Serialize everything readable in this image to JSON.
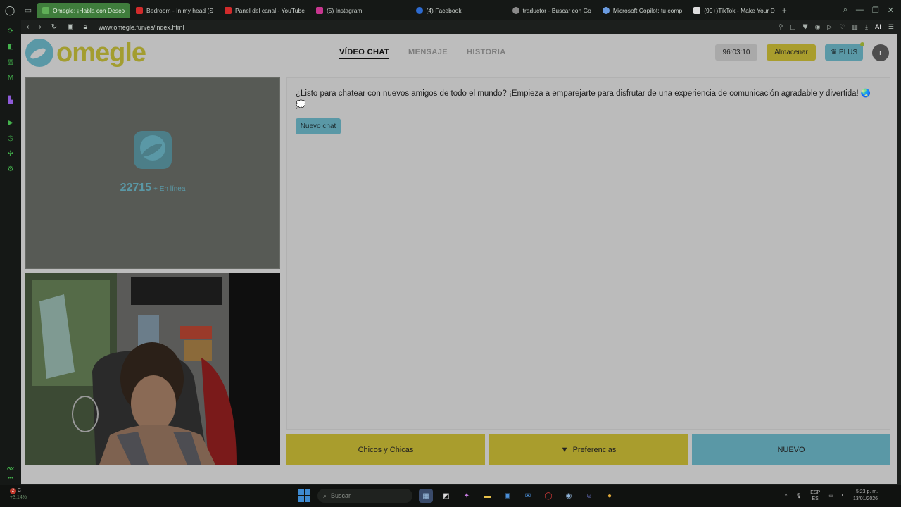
{
  "browser": {
    "tabs": [
      {
        "label": "Omegle: ¡Habla con Desco",
        "color": "#5fae57",
        "active": true
      },
      {
        "label": "Bedroom - In my head (S",
        "color": "#d12b2b",
        "active": false
      },
      {
        "label": "Panel del canal - YouTube",
        "color": "#d12b2b",
        "active": false
      },
      {
        "label": "(5) Instagram",
        "color": "#c8368f",
        "active": false
      },
      {
        "label": "(4) Facebook",
        "color": "#2d6bd1",
        "active": false
      },
      {
        "label": "traductor - Buscar con Go",
        "color": "#8a8a8a",
        "active": false
      },
      {
        "label": "Microsoft Copilot: tu comp",
        "color": "#6a9be0",
        "active": false
      },
      {
        "label": "(99+)TikTok - Make Your D",
        "color": "#dddddd",
        "active": false
      }
    ],
    "url": "www.omegle.fun/es/index.html",
    "ai_label": "AI"
  },
  "site": {
    "logo_text": "omegle",
    "nav": [
      "VÍDEO CHAT",
      "MENSAJE",
      "HISTORIA"
    ],
    "timer": "96:03:10",
    "store_label": "Almacenar",
    "plus_label": "PLUS",
    "avatar_letter": "r"
  },
  "stranger": {
    "online_count": "22715",
    "online_label": "+ En línea"
  },
  "chat": {
    "message": "¿Listo para chatear con nuevos amigos de todo el mundo? ¡Empieza a emparejarte para disfrutar de una experiencia de comunicación agradable y divertida! 🌏 💭",
    "new_chat_label": "Nuevo chat"
  },
  "actions": {
    "gender_label": "Chicos y Chicas",
    "preferences_label": "Preferencias",
    "next_label": "NUEVO"
  },
  "taskbar": {
    "weather_badge": "2",
    "weather_temp": "C",
    "weather_change": "+3.14%",
    "search_placeholder": "Buscar",
    "lang_top": "ESP",
    "lang_bottom": "ES",
    "time": "5:23 p. m.",
    "date": "13/01/2026"
  },
  "sidebar_bottom_label": "GX"
}
